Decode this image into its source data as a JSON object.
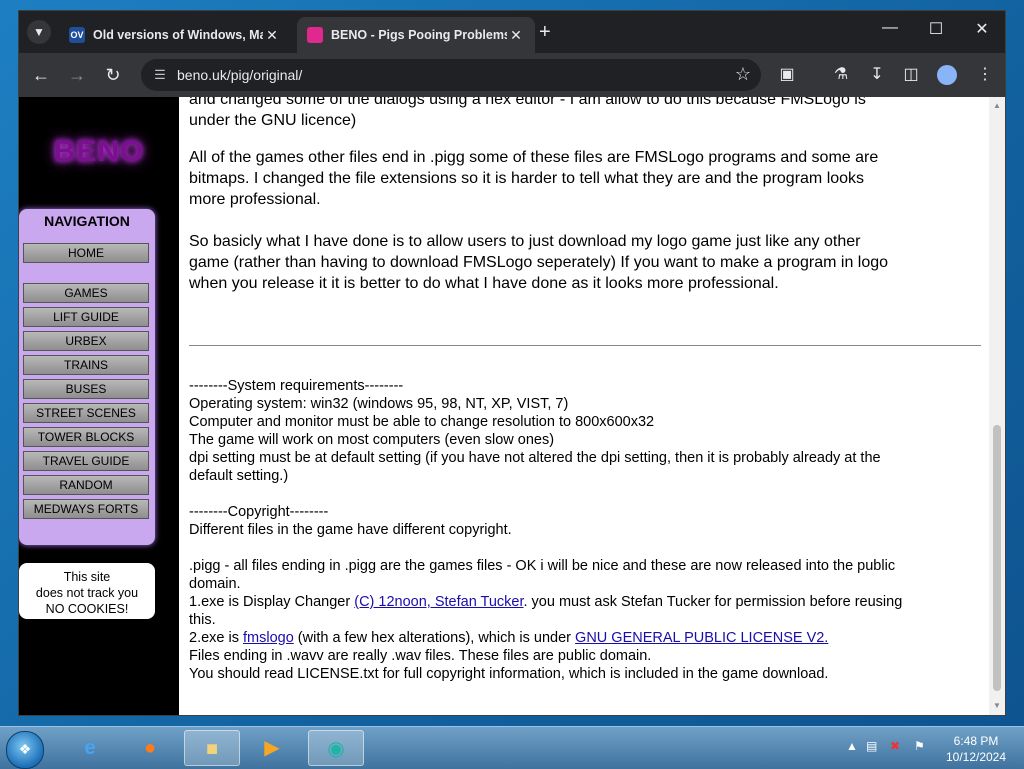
{
  "browser": {
    "tabs": [
      {
        "favicon_text": "OV",
        "favicon_color": "#1f4e9b",
        "title": "Old versions of Windows, Mac"
      },
      {
        "favicon_text": "",
        "favicon_color": "#e0288f",
        "title": "BENO - Pigs Pooing Problems"
      }
    ],
    "url": "beno.uk/pig/original/"
  },
  "sidebar": {
    "logo_text": "BENO",
    "nav_heading": "NAVIGATION",
    "nav_items": [
      "HOME",
      "GAMES",
      "LIFT GUIDE",
      "URBEX",
      "TRAINS",
      "BUSES",
      "STREET SCENES",
      "TOWER BLOCKS",
      "TRAVEL GUIDE",
      "RANDOM",
      "MEDWAYS FORTS"
    ],
    "cookie_line1": "This site",
    "cookie_line2": "does not track you",
    "cookie_line3": "NO COOKIES!"
  },
  "content": {
    "p0_line1": "and changed some of the dialogs using a hex editor - I am allow to do this because FMSLogo is",
    "p0_line2": "under the GNU licence)",
    "p1_line1": "All of the games other files end in .pigg some of these files are FMSLogo programs and some are",
    "p1_line2": "bitmaps. I changed the file extensions so it is harder to tell what they are and the program looks",
    "p1_line3": "more professional.",
    "p2_line1": "So basicly what I have done is to allow users to just download my logo game just like any other",
    "p2_line2": "game (rather than having to download FMSLogo seperately) If you want to make a program in logo",
    "p2_line3": "when you release it it is better to do what I have done as it looks more professional.",
    "sysreq_heading": "--------System requirements--------",
    "sysreq_1": "Operating system: win32 (windows 95, 98, NT, XP, VIST, 7)",
    "sysreq_2": "Computer and monitor must be able to change resolution to 800x600x32",
    "sysreq_3": "The game will work on most computers (even slow ones)",
    "sysreq_4a": "dpi setting must be at default setting (if you have not altered the dpi setting, then it is probably already at the",
    "sysreq_4b": "default setting.)",
    "copy_heading": "--------Copyright--------",
    "copy_1": "Different files in the game have different copyright.",
    "copy_2a": ".pigg - all files ending in .pigg are the games files - OK i will be nice and these are now released into the public",
    "copy_2b": "domain.",
    "copy_3_pre": "1.exe is Display Changer ",
    "copy_3_link": "(C) 12noon, Stefan Tucker",
    "copy_3_post": ". you must ask Stefan Tucker for permission before reusing",
    "copy_3_end": "this.",
    "copy_4_pre": "2.exe is ",
    "copy_4_link1": "fmslogo",
    "copy_4_mid": " (with a few hex alterations), which is under ",
    "copy_4_link2": "GNU GENERAL PUBLIC LICENSE V2.",
    "copy_5": "Files ending in .wavv are really .wav files. These files are public domain.",
    "copy_6": "You should read LICENSE.txt for full copyright information, which is included in the game download."
  },
  "taskbar": {
    "time": "6:48 PM",
    "date": "10/12/2024"
  }
}
